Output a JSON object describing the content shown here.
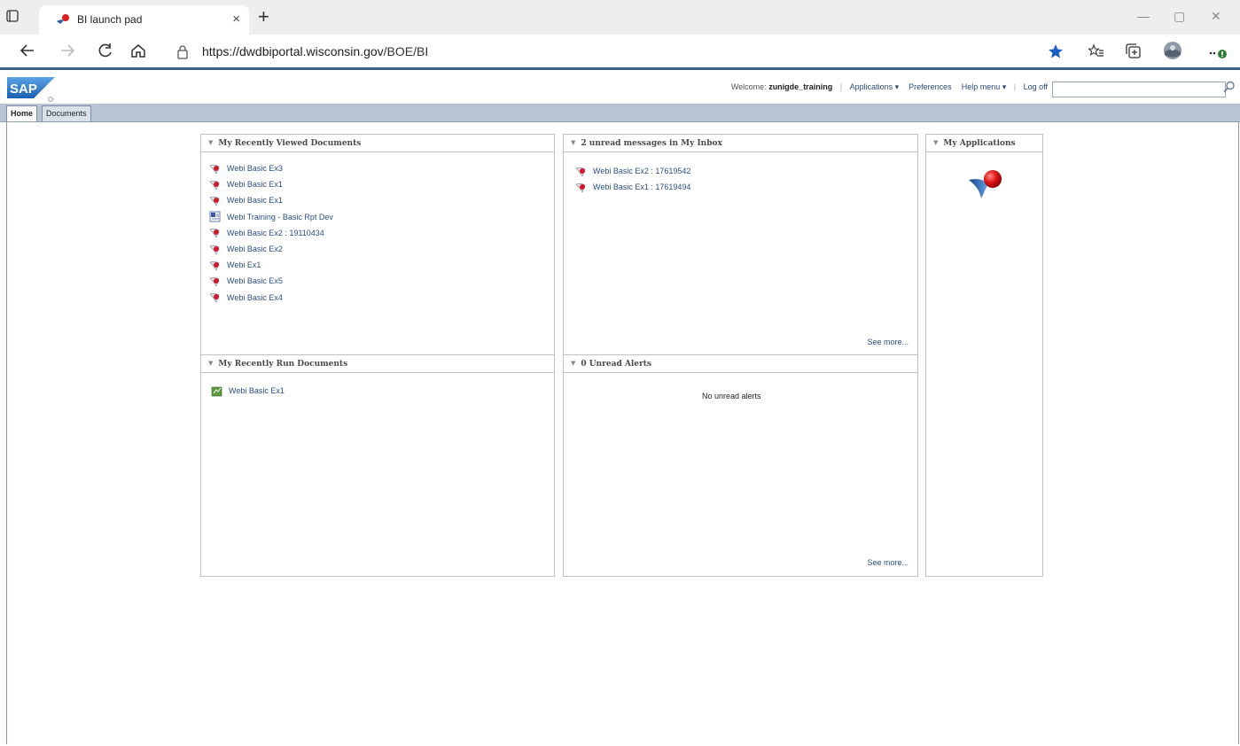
{
  "browser": {
    "tab_title": "BI launch pad",
    "tab_close": "×",
    "new_tab": "+",
    "url_host": "https://dwdbiportal.wisconsin.gov",
    "url_path": "/BOE/BI",
    "icons": [
      "tab-actions-icon",
      "back-icon",
      "forward-icon",
      "refresh-icon",
      "home-icon",
      "lock-icon",
      "favorite-star-icon",
      "favorites-icon",
      "collections-icon",
      "profile-avatar-icon",
      "more-icon"
    ],
    "window_minimize": "—",
    "window_restore": "▢",
    "window_close": "✕"
  },
  "header": {
    "welcome_label": "Welcome:",
    "username": "zunigde_training",
    "applications": "Applications ▾",
    "preferences": "Preferences",
    "help_menu": "Help menu ▾",
    "log_off": "Log off",
    "search_placeholder": ""
  },
  "nav_tabs": [
    {
      "label": "Home"
    },
    {
      "label": "Documents"
    }
  ],
  "panels": {
    "recent_viewed": {
      "title": "My Recently Viewed Documents",
      "items": [
        {
          "label": "Webi Basic Ex3",
          "icon": "webi-doc-icon"
        },
        {
          "label": "Webi Basic Ex1",
          "icon": "webi-doc-icon"
        },
        {
          "label": "Webi Basic Ex1",
          "icon": "webi-doc-icon"
        },
        {
          "label": "Webi Training - Basic Rpt Dev",
          "icon": "word-doc-icon"
        },
        {
          "label": "Webi Basic Ex2 : 19110434",
          "icon": "webi-doc-icon"
        },
        {
          "label": "Webi Basic Ex2",
          "icon": "webi-doc-icon"
        },
        {
          "label": "Webi Ex1",
          "icon": "webi-doc-icon"
        },
        {
          "label": "Webi Basic Ex5",
          "icon": "webi-doc-icon"
        },
        {
          "label": "Webi Basic Ex4",
          "icon": "webi-doc-icon"
        }
      ]
    },
    "inbox": {
      "title": "2 unread messages in My Inbox",
      "items": [
        {
          "label": "Webi Basic Ex2 : 17619542",
          "icon": "webi-doc-icon"
        },
        {
          "label": "Webi Basic Ex1 : 17619494",
          "icon": "webi-doc-icon"
        }
      ],
      "see_more": "See more..."
    },
    "applications": {
      "title": "My Applications"
    },
    "recent_run": {
      "title": "My Recently Run Documents",
      "items": [
        {
          "label": "Webi Basic Ex1",
          "icon": "run-doc-icon"
        }
      ]
    },
    "alerts": {
      "title": "0 Unread Alerts",
      "empty_message": "No unread alerts",
      "see_more": "See more..."
    }
  }
}
